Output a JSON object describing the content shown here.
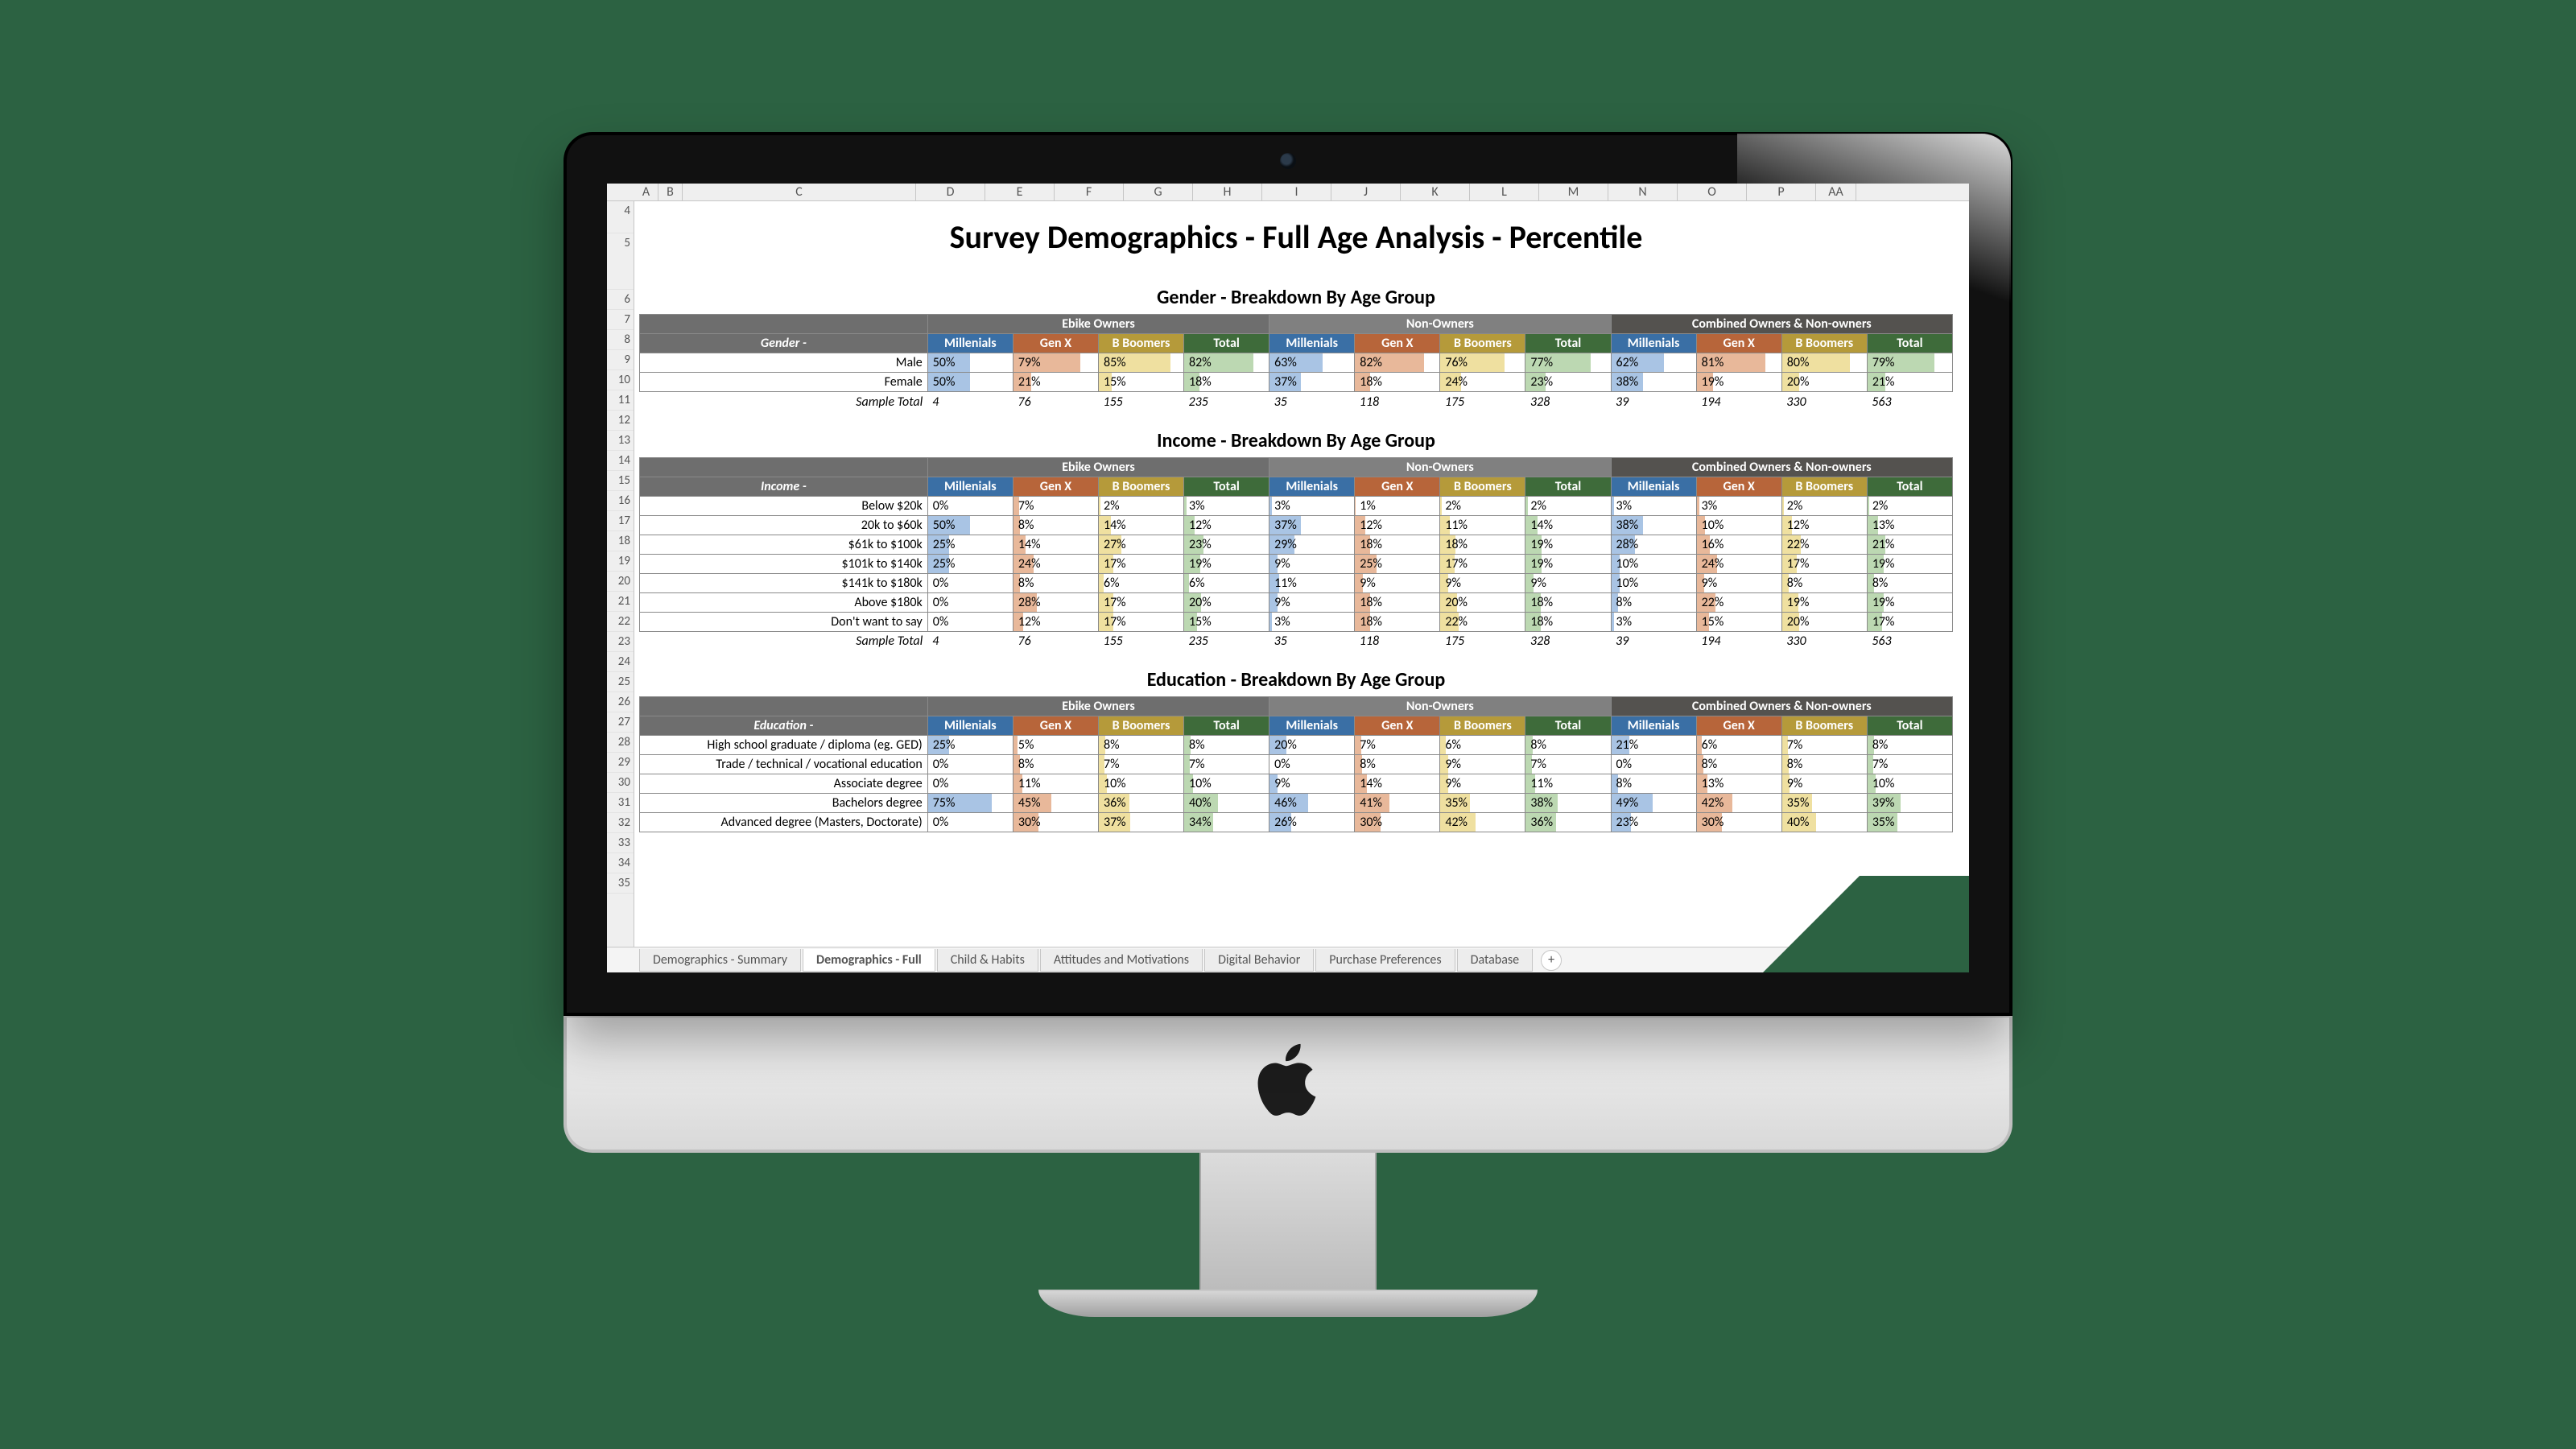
{
  "document": {
    "title": "Survey Demographics - Full Age Analysis - Percentile"
  },
  "column_letters": [
    "A",
    "B",
    "C",
    "D",
    "E",
    "F",
    "G",
    "H",
    "I",
    "J",
    "K",
    "L",
    "M",
    "N",
    "O",
    "P",
    "AA"
  ],
  "row_numbers_start": 4,
  "row_numbers_end": 35,
  "sheet_tabs": {
    "items": [
      "Demographics - Summary",
      "Demographics - Full",
      "Child & Habits",
      "Attitudes and Motivations",
      "Digital Behavior",
      "Purchase Preferences",
      "Database"
    ],
    "active_index": 1
  },
  "groups": [
    "Ebike Owners",
    "Non-Owners",
    "Combined Owners & Non-owners"
  ],
  "subgroups": [
    "Millenials",
    "Gen X",
    "B Boomers",
    "Total"
  ],
  "sample_total_label": "Sample Total",
  "sample_totals": [
    "4",
    "76",
    "155",
    "235",
    "35",
    "118",
    "175",
    "328",
    "39",
    "194",
    "330",
    "563"
  ],
  "sections": [
    {
      "title": "Gender - Breakdown By Age Group",
      "label": "Gender -",
      "rows": [
        {
          "label": "Male",
          "vals": [
            "50%",
            "79%",
            "85%",
            "82%",
            "63%",
            "82%",
            "76%",
            "77%",
            "62%",
            "81%",
            "80%",
            "79%"
          ]
        },
        {
          "label": "Female",
          "vals": [
            "50%",
            "21%",
            "15%",
            "18%",
            "37%",
            "18%",
            "24%",
            "23%",
            "38%",
            "19%",
            "20%",
            "21%"
          ]
        }
      ],
      "show_sample": true
    },
    {
      "title": "Income - Breakdown By Age Group",
      "label": "Income -",
      "rows": [
        {
          "label": "Below $20k",
          "vals": [
            "0%",
            "7%",
            "2%",
            "3%",
            "3%",
            "1%",
            "2%",
            "2%",
            "3%",
            "3%",
            "2%",
            "2%"
          ]
        },
        {
          "label": "20k to $60k",
          "vals": [
            "50%",
            "8%",
            "14%",
            "12%",
            "37%",
            "12%",
            "11%",
            "14%",
            "38%",
            "10%",
            "12%",
            "13%"
          ]
        },
        {
          "label": "$61k to $100k",
          "vals": [
            "25%",
            "14%",
            "27%",
            "23%",
            "29%",
            "18%",
            "18%",
            "19%",
            "28%",
            "16%",
            "22%",
            "21%"
          ]
        },
        {
          "label": "$101k to $140k",
          "vals": [
            "25%",
            "24%",
            "17%",
            "19%",
            "9%",
            "25%",
            "17%",
            "19%",
            "10%",
            "24%",
            "17%",
            "19%"
          ]
        },
        {
          "label": "$141k to $180k",
          "vals": [
            "0%",
            "8%",
            "6%",
            "6%",
            "11%",
            "9%",
            "9%",
            "9%",
            "10%",
            "9%",
            "8%",
            "8%"
          ]
        },
        {
          "label": "Above $180k",
          "vals": [
            "0%",
            "28%",
            "17%",
            "20%",
            "9%",
            "18%",
            "20%",
            "18%",
            "8%",
            "22%",
            "19%",
            "19%"
          ]
        },
        {
          "label": "Don't want to say",
          "vals": [
            "0%",
            "12%",
            "17%",
            "15%",
            "3%",
            "18%",
            "22%",
            "18%",
            "3%",
            "15%",
            "20%",
            "17%"
          ]
        }
      ],
      "show_sample": true
    },
    {
      "title": "Education - Breakdown By Age Group",
      "label": "Education -",
      "rows": [
        {
          "label": "High school graduate / diploma (eg. GED)",
          "vals": [
            "25%",
            "5%",
            "8%",
            "8%",
            "20%",
            "7%",
            "6%",
            "8%",
            "21%",
            "6%",
            "7%",
            "8%"
          ]
        },
        {
          "label": "Trade / technical / vocational education",
          "vals": [
            "0%",
            "8%",
            "7%",
            "7%",
            "0%",
            "8%",
            "9%",
            "7%",
            "0%",
            "8%",
            "8%",
            "7%"
          ]
        },
        {
          "label": "Associate degree",
          "vals": [
            "0%",
            "11%",
            "10%",
            "10%",
            "9%",
            "14%",
            "9%",
            "11%",
            "8%",
            "13%",
            "9%",
            "10%"
          ]
        },
        {
          "label": "Bachelors degree",
          "vals": [
            "75%",
            "45%",
            "36%",
            "40%",
            "46%",
            "41%",
            "35%",
            "38%",
            "49%",
            "42%",
            "35%",
            "39%"
          ]
        },
        {
          "label": "Advanced degree (Masters, Doctorate)",
          "vals": [
            "0%",
            "30%",
            "37%",
            "34%",
            "26%",
            "30%",
            "42%",
            "36%",
            "23%",
            "30%",
            "40%",
            "35%"
          ]
        }
      ],
      "show_sample": false
    }
  ]
}
